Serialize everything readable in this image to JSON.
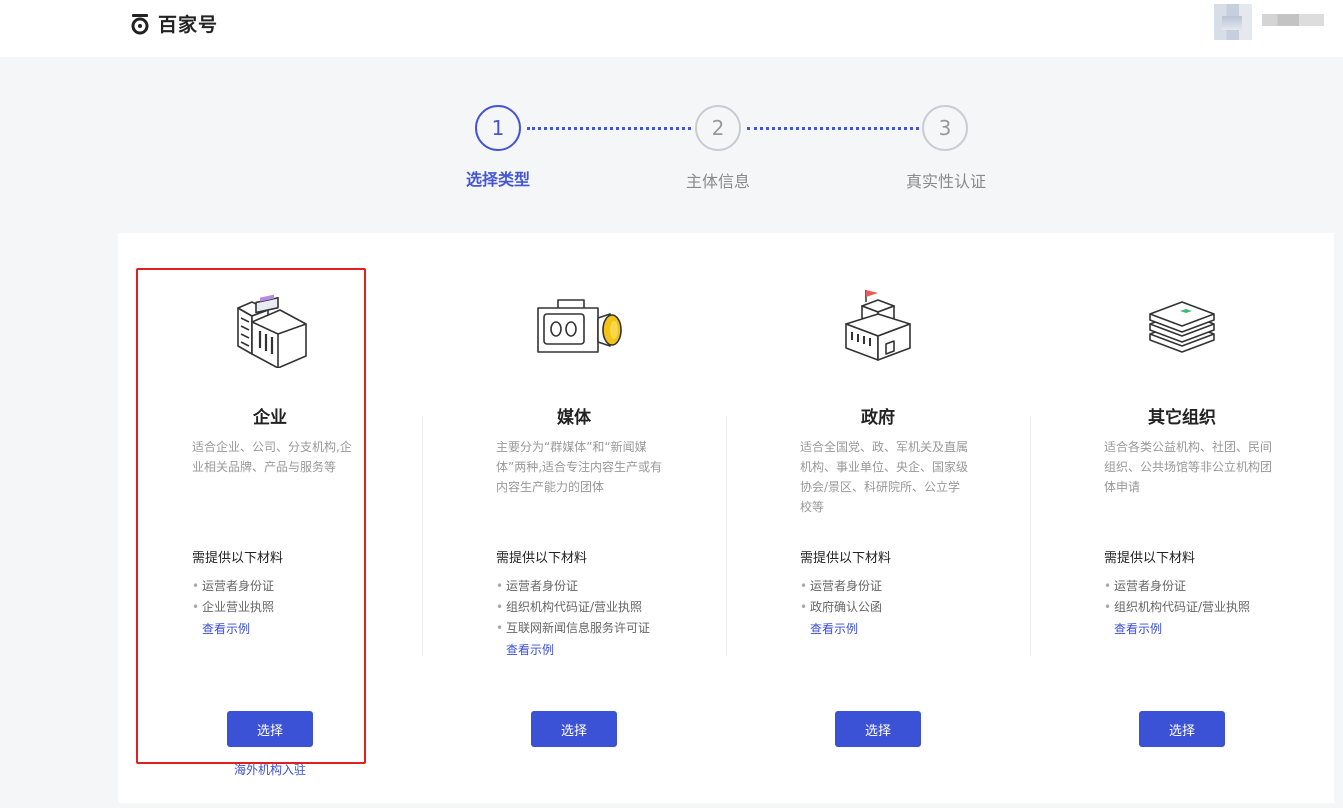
{
  "header": {
    "logo_text": "百家号",
    "username": ""
  },
  "steps": [
    {
      "number": "1",
      "label": "选择类型",
      "active": true
    },
    {
      "number": "2",
      "label": "主体信息",
      "active": false
    },
    {
      "number": "3",
      "label": "真实性认证",
      "active": false
    }
  ],
  "types": [
    {
      "title": "企业",
      "description": "适合企业、公司、分支机构,企业相关品牌、产品与服务等",
      "materials_title": "需提供以下材料",
      "materials": [
        "运营者身份证",
        "企业营业执照"
      ],
      "example_link": "查看示例",
      "select_label": "选择",
      "icon": "building-icon"
    },
    {
      "title": "媒体",
      "description": "主要分为“群媒体”和“新闻媒体”两种,适合专注内容生产或有内容生产能力的团体",
      "materials_title": "需提供以下材料",
      "materials": [
        "运营者身份证",
        "组织机构代码证/营业执照",
        "互联网新闻信息服务许可证"
      ],
      "example_link": "查看示例",
      "select_label": "选择",
      "icon": "video-camera-icon"
    },
    {
      "title": "政府",
      "description": "适合全国党、政、军机关及直属机构、事业单位、央企、国家级协会/景区、科研院所、公立学校等",
      "materials_title": "需提供以下材料",
      "materials": [
        "运营者身份证",
        "政府确认公函"
      ],
      "example_link": "查看示例",
      "select_label": "选择",
      "icon": "government-building-icon"
    },
    {
      "title": "其它组织",
      "description": "适合各类公益机构、社团、民间组织、公共场馆等非公立机构团体申请",
      "materials_title": "需提供以下材料",
      "materials": [
        "运营者身份证",
        "组织机构代码证/营业执照"
      ],
      "example_link": "查看示例",
      "select_label": "选择",
      "icon": "layers-icon"
    }
  ],
  "overseas_link": "海外机构入驻",
  "colors": {
    "primary": "#3c52d6",
    "highlight": "#e02020"
  }
}
